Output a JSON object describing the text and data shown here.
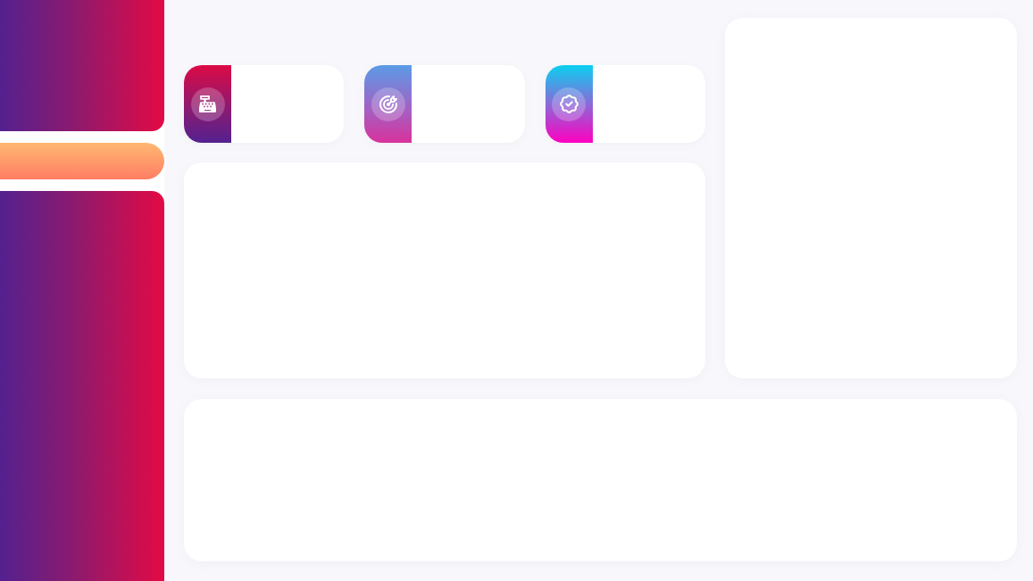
{
  "sidebar": {
    "blocks": [
      {
        "kind": "header"
      },
      {
        "kind": "highlight"
      },
      {
        "kind": "menu"
      }
    ]
  },
  "stat_cards": [
    {
      "kind": "register"
    },
    {
      "kind": "target"
    },
    {
      "kind": "badge"
    }
  ],
  "cards": [
    {
      "kind": "main"
    },
    {
      "kind": "side"
    },
    {
      "kind": "bottom"
    }
  ]
}
